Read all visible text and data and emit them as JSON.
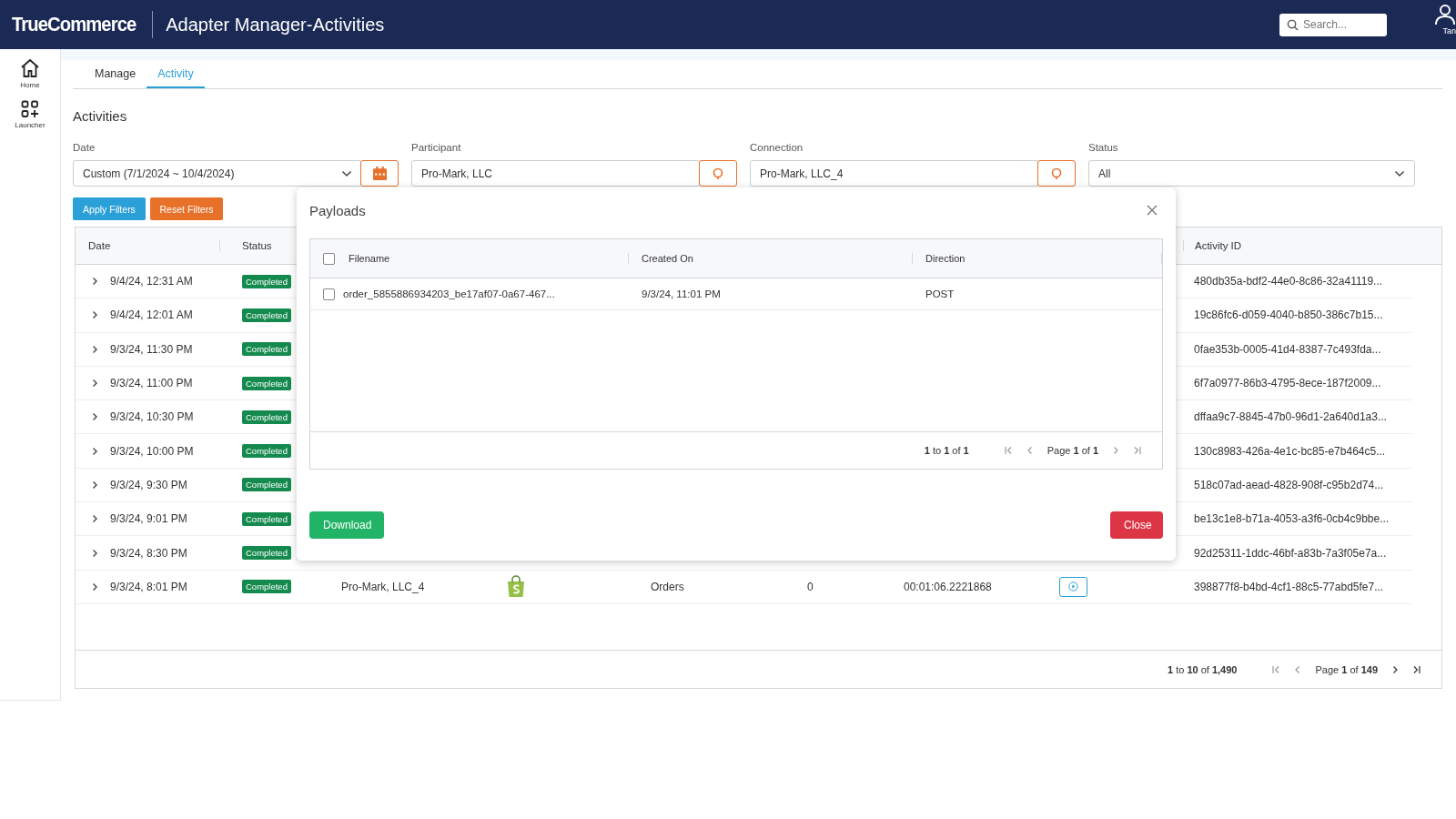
{
  "app": {
    "logo": "TrueCommerce",
    "title": "Adapter Manager-Activities",
    "search": {
      "placeholder": "Search..."
    },
    "user": "Tan"
  },
  "sidebar": [
    {
      "label": "Home",
      "kind": "home"
    },
    {
      "label": "Launcher",
      "kind": "launcher"
    }
  ],
  "tabs": [
    {
      "label": "Manage",
      "selected": false
    },
    {
      "label": "Activity",
      "selected": true
    }
  ],
  "section_title": "Activities",
  "filters": [
    {
      "label": "Date",
      "kind": "date",
      "value": "Custom (7/1/2024 ~ 10/4/2024)"
    },
    {
      "label": "Participant",
      "kind": "lookup",
      "value": "Pro-Mark, LLC"
    },
    {
      "label": "Connection",
      "kind": "lookup",
      "value": "Pro-Mark, LLC_4"
    },
    {
      "label": "Status",
      "kind": "select",
      "value": "All"
    }
  ],
  "filter_buttons": [
    {
      "label": "Apply Filters",
      "kind": "apply"
    },
    {
      "label": "Reset Filters",
      "kind": "reset"
    }
  ],
  "table": {
    "columns": [
      "Date",
      "Status",
      "Activity ID"
    ],
    "rows": [
      {
        "date": "9/4/24, 12:31 AM",
        "status": "Completed",
        "activity_id": "480db35a-bdf2-44e0-8c86-32a41119..."
      },
      {
        "date": "9/4/24, 12:01 AM",
        "status": "Completed",
        "activity_id": "19c86fc6-d059-4040-b850-386c7b15..."
      },
      {
        "date": "9/3/24, 11:30 PM",
        "status": "Completed",
        "activity_id": "0fae353b-0005-41d4-8387-7c493fda..."
      },
      {
        "date": "9/3/24, 11:00 PM",
        "status": "Completed",
        "activity_id": "6f7a0977-86b3-4795-8ece-187f2009..."
      },
      {
        "date": "9/3/24, 10:30 PM",
        "status": "Completed",
        "activity_id": "dffaa9c7-8845-47b0-96d1-2a640d1a3..."
      },
      {
        "date": "9/3/24, 10:00 PM",
        "status": "Completed",
        "activity_id": "130c8983-426a-4e1c-bc85-e7b464c5..."
      },
      {
        "date": "9/3/24, 9:30 PM",
        "status": "Completed",
        "activity_id": "518c07ad-aead-4828-908f-c95b2d74..."
      },
      {
        "date": "9/3/24, 9:01 PM",
        "status": "Completed",
        "activity_id": "be13c1e8-b71a-4053-a3f6-0cb4c9bbe..."
      },
      {
        "date": "9/3/24, 8:30 PM",
        "status": "Completed",
        "activity_id": "92d25311-1ddc-46bf-a83b-7a3f05e7a..."
      },
      {
        "date": "9/3/24, 8:01 PM",
        "status": "Completed",
        "participant": "Pro-Mark, LLC_4",
        "type": "Orders",
        "count": "0",
        "duration": "00:01:06.2221868",
        "activity_id": "398877f8-b4bd-4cf1-88c5-77abd5fe7..."
      }
    ],
    "range": "**1** to **10** of **1,490**",
    "page": "Page **1** of **149**"
  },
  "modal": {
    "title": "Payloads",
    "columns": [
      "Filename",
      "Created On",
      "Direction"
    ],
    "select_all_checked": false,
    "rows": [
      {
        "checked": false,
        "filename": "order_5855886934203_be17af07-0a67-467...",
        "created_on": "9/3/24, 11:01 PM",
        "direction": "POST"
      }
    ],
    "range": "**1** to **1** of **1**",
    "page": "Page **1** of **1**",
    "buttons": [
      {
        "label": "Download",
        "kind": "download"
      },
      {
        "label": "Close",
        "kind": "close"
      }
    ]
  }
}
